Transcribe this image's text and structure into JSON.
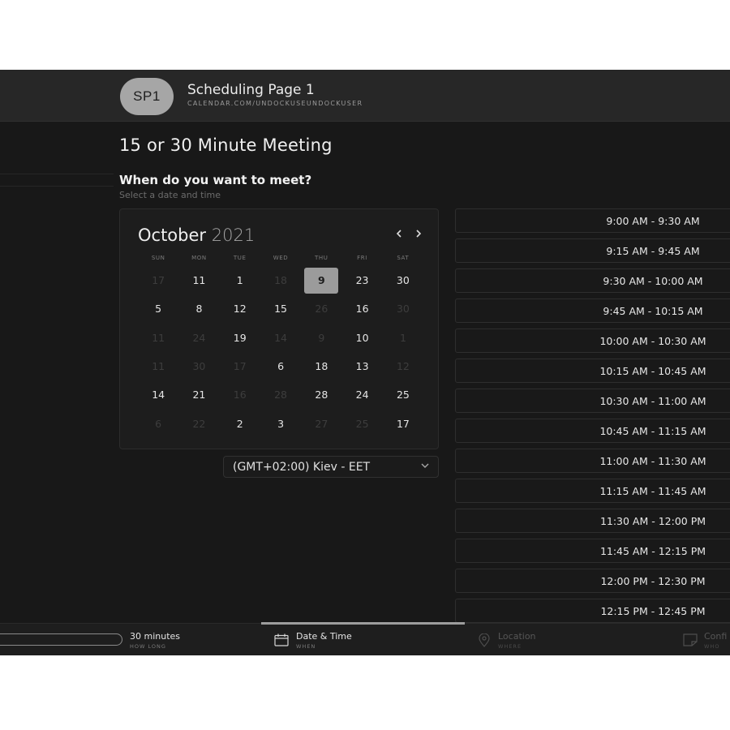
{
  "header": {
    "avatar_initials": "SP1",
    "page_name": "Scheduling Page 1",
    "page_url": "CALENDAR.COM/UNDOCKUSEUNDOCKUSER"
  },
  "meeting": {
    "title": "15 or 30 Minute Meeting",
    "question": "When do you want to meet?",
    "question_sub": "Select a date and time"
  },
  "calendar": {
    "month": "October",
    "year": "2021",
    "prev_icon": "chevron-left-icon",
    "next_icon": "chevron-right-icon",
    "weekdays": [
      "SUN",
      "MON",
      "TUE",
      "WED",
      "THU",
      "FRI",
      "SAT"
    ],
    "weeks": [
      [
        {
          "d": "17",
          "dim": true
        },
        {
          "d": "11"
        },
        {
          "d": "1"
        },
        {
          "d": "18",
          "dim": true
        },
        {
          "d": "9",
          "sel": true
        },
        {
          "d": "23"
        },
        {
          "d": "30"
        }
      ],
      [
        {
          "d": "5"
        },
        {
          "d": "8"
        },
        {
          "d": "12"
        },
        {
          "d": "15"
        },
        {
          "d": "26",
          "dim": true
        },
        {
          "d": "16"
        },
        {
          "d": "30",
          "dim": true
        }
      ],
      [
        {
          "d": "11",
          "dim": true
        },
        {
          "d": "24",
          "dim": true
        },
        {
          "d": "19"
        },
        {
          "d": "14",
          "dim": true
        },
        {
          "d": "9",
          "dim": true
        },
        {
          "d": "10"
        },
        {
          "d": "1",
          "dim": true
        }
      ],
      [
        {
          "d": "11",
          "dim": true
        },
        {
          "d": "30",
          "dim": true
        },
        {
          "d": "17",
          "dim": true
        },
        {
          "d": "6"
        },
        {
          "d": "18"
        },
        {
          "d": "13"
        },
        {
          "d": "12",
          "dim": true
        }
      ],
      [
        {
          "d": "14"
        },
        {
          "d": "21"
        },
        {
          "d": "16",
          "dim": true
        },
        {
          "d": "28",
          "dim": true
        },
        {
          "d": "28"
        },
        {
          "d": "24"
        },
        {
          "d": "25"
        }
      ],
      [
        {
          "d": "6",
          "dim": true
        },
        {
          "d": "22",
          "dim": true
        },
        {
          "d": "2"
        },
        {
          "d": "3"
        },
        {
          "d": "27",
          "dim": true
        },
        {
          "d": "25",
          "dim": true
        },
        {
          "d": "17"
        }
      ]
    ]
  },
  "timezone": {
    "value": "(GMT+02:00) Kiev - EET",
    "icon": "chevron-down-icon"
  },
  "slots": [
    "9:00 AM - 9:30 AM",
    "9:15 AM - 9:45 AM",
    "9:30 AM - 10:00 AM",
    "9:45 AM - 10:15 AM",
    "10:00 AM - 10:30 AM",
    "10:15 AM - 10:45 AM",
    "10:30 AM - 11:00 AM",
    "10:45 AM - 11:15 AM",
    "11:00 AM - 11:30 AM",
    "11:15 AM - 11:45 AM",
    "11:30 AM - 12:00 PM",
    "11:45 AM - 12:15 PM",
    "12:00 PM - 12:30 PM",
    "12:15 PM - 12:45 PM"
  ],
  "steps": {
    "duration": {
      "label": "30 minutes",
      "sub": "HOW LONG"
    },
    "datetime": {
      "label": "Date & Time",
      "sub": "WHEN",
      "icon": "calendar-icon"
    },
    "location": {
      "label": "Location",
      "sub": "WHERE",
      "icon": "location-pin-icon"
    },
    "confirm": {
      "label": "Confi",
      "sub": "WHO",
      "icon": "note-icon"
    }
  },
  "colors": {
    "background": "#181818",
    "header": "#272727",
    "selected_day": "#9b9b9b"
  }
}
